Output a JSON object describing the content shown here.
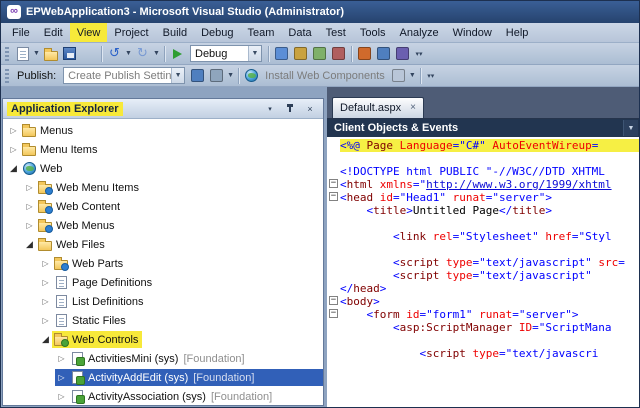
{
  "colors": {
    "annotation_highlight": "#f7e93a",
    "selection_blue": "#3160b8",
    "directive_background": "#f6ef44",
    "title_bar_blue": "#2c4a7a",
    "editor_header_navy": "#223550"
  },
  "window": {
    "title": "EPWebApplication3 - Microsoft Visual Studio (Administrator)",
    "logo_glyph": "∞"
  },
  "menu_bar": {
    "items": [
      {
        "label": "File"
      },
      {
        "label": "Edit"
      },
      {
        "label": "View",
        "highlighted": true
      },
      {
        "label": "Project"
      },
      {
        "label": "Build"
      },
      {
        "label": "Debug"
      },
      {
        "label": "Team"
      },
      {
        "label": "Data"
      },
      {
        "label": "Test"
      },
      {
        "label": "Tools"
      },
      {
        "label": "Analyze"
      },
      {
        "label": "Window"
      },
      {
        "label": "Help"
      }
    ]
  },
  "toolbar_standard": {
    "items": [
      {
        "type": "grip",
        "name": "standard-toolbar-grip"
      },
      {
        "type": "icon",
        "name": "new-item-icon",
        "icon": "page",
        "dropdown": true
      },
      {
        "type": "icon",
        "name": "open-file-icon",
        "icon": "folder"
      },
      {
        "type": "icon",
        "name": "save-icon",
        "icon": "floppy"
      },
      {
        "type": "icon",
        "name": "save-all-icon",
        "icon": "floppy2"
      },
      {
        "type": "sep"
      },
      {
        "type": "icon",
        "name": "undo-icon",
        "icon": "undo",
        "glyph": "↺",
        "dropdown": true
      },
      {
        "type": "icon",
        "name": "redo-icon",
        "icon": "redo",
        "glyph": "↻",
        "dropdown": true,
        "disabled": true
      },
      {
        "type": "sep"
      },
      {
        "type": "icon",
        "name": "start-debugging-icon",
        "icon": "play"
      },
      {
        "type": "combo",
        "name": "solution-configurations-combo",
        "value": "Debug",
        "width": 72
      },
      {
        "type": "sep"
      },
      {
        "type": "icon",
        "name": "find-icon",
        "icon": "gen",
        "color": "#5b8ed6"
      },
      {
        "type": "icon",
        "name": "solution-explorer-icon",
        "icon": "gen",
        "color": "#c9a23f"
      },
      {
        "type": "icon",
        "name": "properties-window-icon",
        "icon": "gen",
        "color": "#7fb069"
      },
      {
        "type": "icon",
        "name": "toolbox-icon",
        "icon": "gen",
        "color": "#b05f5f"
      },
      {
        "type": "sep"
      },
      {
        "type": "icon",
        "name": "error-list-icon",
        "icon": "gen",
        "color": "#d06a2c"
      },
      {
        "type": "icon",
        "name": "output-window-icon",
        "icon": "gen",
        "color": "#4f7fbf"
      },
      {
        "type": "icon",
        "name": "extension-manager-icon",
        "icon": "gen",
        "color": "#6b5fb0"
      },
      {
        "type": "overflow",
        "name": "standard-toolbar-overflow"
      }
    ]
  },
  "toolbar_publish": {
    "items": [
      {
        "type": "grip",
        "name": "publish-toolbar-grip"
      },
      {
        "type": "label",
        "name": "publish-label",
        "text": "Publish:"
      },
      {
        "type": "combo",
        "name": "publish-settings-combo",
        "value": "Create Publish Settings",
        "width": 122,
        "muted": true
      },
      {
        "type": "icon",
        "name": "publish-icon",
        "icon": "gen",
        "color": "#4f7fbf"
      },
      {
        "type": "icon",
        "name": "publish-options-icon",
        "icon": "gen",
        "color": "#8fa5bd",
        "dropdown": true
      },
      {
        "type": "sep"
      },
      {
        "type": "icon",
        "name": "install-web-components-icon",
        "icon": "globe"
      },
      {
        "type": "label",
        "name": "install-web-components-label",
        "text": "Install Web Components",
        "muted": true
      },
      {
        "type": "icon",
        "name": "install-web-components-dropdown-icon",
        "icon": "gen",
        "color": "#b9c6d8",
        "dropdown": true
      },
      {
        "type": "sep"
      },
      {
        "type": "overflow",
        "name": "publish-toolbar-overflow"
      }
    ]
  },
  "explorer": {
    "title": "Application Explorer",
    "buttons": {
      "window_position": "▾",
      "close": "×"
    },
    "items": [
      {
        "label": "Menus",
        "icon": "folder",
        "level": 0,
        "children": true,
        "expanded": false
      },
      {
        "label": "Menu Items",
        "icon": "folder",
        "level": 0,
        "children": true,
        "expanded": false
      },
      {
        "label": "Web",
        "icon": "globe",
        "level": 0,
        "children": true,
        "expanded": true
      },
      {
        "label": "Web Menu Items",
        "icon": "webfolder",
        "level": 1,
        "children": true,
        "expanded": false
      },
      {
        "label": "Web Content",
        "icon": "webfolder",
        "level": 1,
        "children": true,
        "expanded": false
      },
      {
        "label": "Web Menus",
        "icon": "webfolder",
        "level": 1,
        "children": true,
        "expanded": false
      },
      {
        "label": "Web Files",
        "icon": "folder",
        "level": 1,
        "children": true,
        "expanded": true
      },
      {
        "label": "Web Parts",
        "icon": "webfolder",
        "level": 2,
        "children": true,
        "expanded": false
      },
      {
        "label": "Page Definitions",
        "icon": "doc",
        "level": 2,
        "children": true,
        "expanded": false
      },
      {
        "label": "List Definitions",
        "icon": "doc",
        "level": 2,
        "children": true,
        "expanded": false
      },
      {
        "label": "Static Files",
        "icon": "doc",
        "level": 2,
        "children": true,
        "expanded": false
      },
      {
        "label": "Web Controls",
        "icon": "foldergear",
        "level": 2,
        "children": true,
        "expanded": true,
        "highlighted": true
      },
      {
        "label": "ActivitiesMini (sys)",
        "suffix": "[Foundation]",
        "icon": "ctrl",
        "level": 3,
        "children": true,
        "expanded": false
      },
      {
        "label": "ActivityAddEdit (sys)",
        "suffix": "[Foundation]",
        "icon": "ctrl",
        "level": 3,
        "children": true,
        "expanded": false,
        "selected": true
      },
      {
        "label": "ActivityAssociation (sys)",
        "suffix": "[Foundation]",
        "icon": "ctrl",
        "level": 3,
        "children": true,
        "expanded": false
      }
    ]
  },
  "editor": {
    "tab_label": "Default.aspx",
    "tab_close": "×",
    "dropdown_label": "Client Objects & Events",
    "code_lines": [
      {
        "directive": true,
        "segs": [
          [
            "d",
            "<%@ "
          ],
          [
            "tag",
            "Page"
          ],
          [
            "txt",
            " "
          ],
          [
            "attr",
            "Language"
          ],
          [
            "d",
            "="
          ],
          [
            "val",
            "\"C#\""
          ],
          [
            "txt",
            " "
          ],
          [
            "attr",
            "AutoEventWireup"
          ],
          [
            "d",
            "="
          ]
        ]
      },
      {
        "segs": []
      },
      {
        "segs": [
          [
            "d",
            "<!DOCTYPE html PUBLIC \"-//W3C//DTD XHTML"
          ]
        ]
      },
      {
        "fold": true,
        "segs": [
          [
            "d",
            "<"
          ],
          [
            "tag",
            "html"
          ],
          [
            "txt",
            " "
          ],
          [
            "attr",
            "xmlns"
          ],
          [
            "d",
            "=\""
          ],
          [
            "url",
            "http://www.w3.org/1999/xhtml"
          ]
        ]
      },
      {
        "fold": true,
        "segs": [
          [
            "d",
            "<"
          ],
          [
            "tag",
            "head"
          ],
          [
            "txt",
            " "
          ],
          [
            "attr",
            "id"
          ],
          [
            "d",
            "="
          ],
          [
            "val",
            "\"Head1\""
          ],
          [
            "txt",
            " "
          ],
          [
            "attr",
            "runat"
          ],
          [
            "d",
            "="
          ],
          [
            "val",
            "\"server\""
          ],
          [
            "d",
            ">"
          ]
        ]
      },
      {
        "segs": [
          [
            "txt",
            "    "
          ],
          [
            "d",
            "<"
          ],
          [
            "tag",
            "title"
          ],
          [
            "d",
            ">"
          ],
          [
            "txt",
            "Untitled Page"
          ],
          [
            "d",
            "</"
          ],
          [
            "tag",
            "title"
          ],
          [
            "d",
            ">"
          ]
        ]
      },
      {
        "segs": []
      },
      {
        "segs": [
          [
            "txt",
            "        "
          ],
          [
            "d",
            "<"
          ],
          [
            "tag",
            "link"
          ],
          [
            "txt",
            " "
          ],
          [
            "attr",
            "rel"
          ],
          [
            "d",
            "="
          ],
          [
            "val",
            "\"Stylesheet\""
          ],
          [
            "txt",
            " "
          ],
          [
            "attr",
            "href"
          ],
          [
            "d",
            "="
          ],
          [
            "val",
            "\"Styl"
          ]
        ]
      },
      {
        "segs": []
      },
      {
        "segs": [
          [
            "txt",
            "        "
          ],
          [
            "d",
            "<"
          ],
          [
            "tag",
            "script"
          ],
          [
            "txt",
            " "
          ],
          [
            "attr",
            "type"
          ],
          [
            "d",
            "="
          ],
          [
            "val",
            "\"text/javascript\""
          ],
          [
            "txt",
            " "
          ],
          [
            "attr",
            "src"
          ],
          [
            "d",
            "="
          ]
        ]
      },
      {
        "segs": [
          [
            "txt",
            "        "
          ],
          [
            "d",
            "<"
          ],
          [
            "tag",
            "script"
          ],
          [
            "txt",
            " "
          ],
          [
            "attr",
            "type"
          ],
          [
            "d",
            "="
          ],
          [
            "val",
            "\"text/javascript\""
          ]
        ]
      },
      {
        "segs": [
          [
            "d",
            "</"
          ],
          [
            "tag",
            "head"
          ],
          [
            "d",
            ">"
          ]
        ]
      },
      {
        "fold": true,
        "segs": [
          [
            "d",
            "<"
          ],
          [
            "tag",
            "body"
          ],
          [
            "d",
            ">"
          ]
        ]
      },
      {
        "fold": true,
        "segs": [
          [
            "txt",
            "    "
          ],
          [
            "d",
            "<"
          ],
          [
            "tag",
            "form"
          ],
          [
            "txt",
            " "
          ],
          [
            "attr",
            "id"
          ],
          [
            "d",
            "="
          ],
          [
            "val",
            "\"form1\""
          ],
          [
            "txt",
            " "
          ],
          [
            "attr",
            "runat"
          ],
          [
            "d",
            "="
          ],
          [
            "val",
            "\"server\""
          ],
          [
            "d",
            ">"
          ]
        ]
      },
      {
        "segs": [
          [
            "txt",
            "        "
          ],
          [
            "d",
            "<"
          ],
          [
            "tag",
            "asp:ScriptManager"
          ],
          [
            "txt",
            " "
          ],
          [
            "attr",
            "ID"
          ],
          [
            "d",
            "="
          ],
          [
            "val",
            "\"ScriptMana"
          ]
        ]
      },
      {
        "segs": []
      },
      {
        "segs": [
          [
            "txt",
            "            "
          ],
          [
            "d",
            "<"
          ],
          [
            "tag",
            "script"
          ],
          [
            "txt",
            " "
          ],
          [
            "attr",
            "type"
          ],
          [
            "d",
            "="
          ],
          [
            "val",
            "\"text/javascri"
          ]
        ]
      }
    ]
  }
}
